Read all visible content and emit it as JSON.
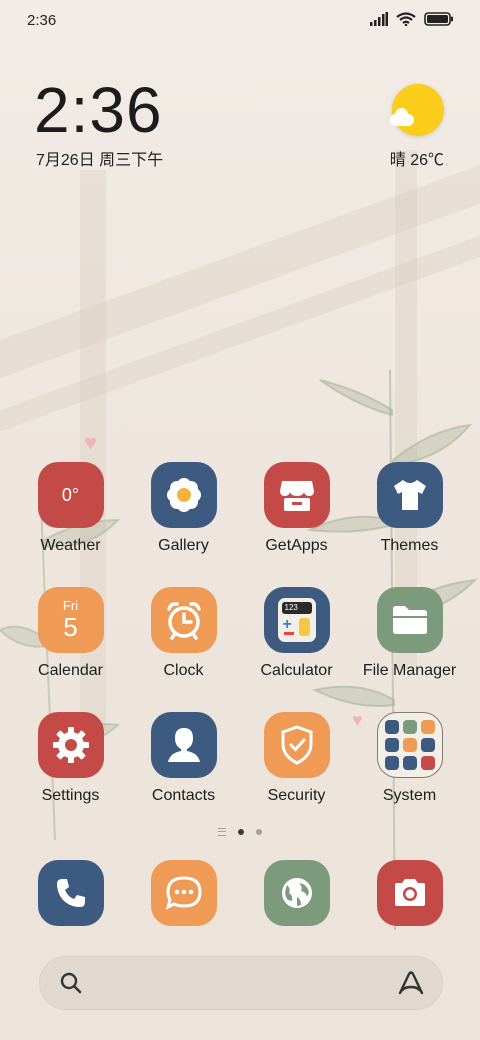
{
  "status_bar": {
    "time": "2:36"
  },
  "clock_widget": {
    "time": "2:36",
    "date": "7月26日 周三下午"
  },
  "weather_widget": {
    "text": "晴 26℃"
  },
  "apps": {
    "weather": {
      "label": "Weather",
      "temp": "0°"
    },
    "gallery": {
      "label": "Gallery"
    },
    "getapps": {
      "label": "GetApps"
    },
    "themes": {
      "label": "Themes"
    },
    "calendar": {
      "label": "Calendar",
      "day": "Fri",
      "date": "5"
    },
    "clock": {
      "label": "Clock"
    },
    "calculator": {
      "label": "Calculator",
      "display": "123"
    },
    "file_manager": {
      "label": "File Manager"
    },
    "settings": {
      "label": "Settings"
    },
    "contacts": {
      "label": "Contacts"
    },
    "security": {
      "label": "Security"
    },
    "system": {
      "label": "System"
    }
  },
  "dock": [
    "phone-icon",
    "messages-icon",
    "browser-icon",
    "camera-icon"
  ],
  "search_bar": {
    "left_icon": "search-icon",
    "right_icon": "assistant-icon"
  },
  "page_indicator": {
    "pages": 2,
    "active": 1
  },
  "colors": {
    "red": "#c34a47",
    "navy": "#3d5a80",
    "orange": "#ef9a55",
    "green": "#7c9b7d",
    "cream": "#f4efe6"
  }
}
